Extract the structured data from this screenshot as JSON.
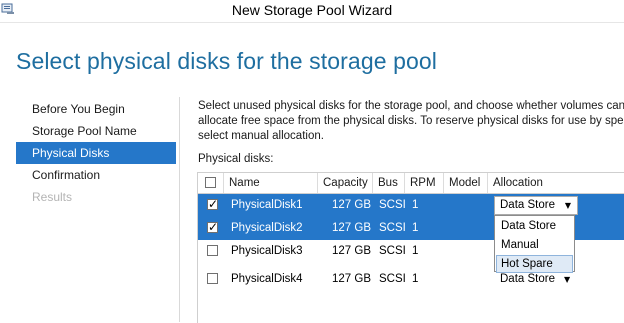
{
  "window": {
    "title": "New Storage Pool Wizard"
  },
  "page": {
    "heading": "Select physical disks for the storage pool"
  },
  "nav": {
    "items": [
      {
        "label": "Before You Begin",
        "state": "normal"
      },
      {
        "label": "Storage Pool Name",
        "state": "normal"
      },
      {
        "label": "Physical Disks",
        "state": "active"
      },
      {
        "label": "Confirmation",
        "state": "normal"
      },
      {
        "label": "Results",
        "state": "disabled"
      }
    ]
  },
  "content": {
    "description_lines": [
      "Select unused physical disks for the storage pool, and choose whether volumes can au",
      "allocate free space from the physical disks. To reserve physical disks for use by specific",
      "select manual allocation."
    ],
    "disks_label": "Physical disks:",
    "columns": [
      "Name",
      "Capacity",
      "Bus",
      "RPM",
      "Model",
      "Allocation"
    ],
    "rows": [
      {
        "checked": true,
        "selected": true,
        "name": "PhysicalDisk1",
        "capacity": "127 GB",
        "bus": "SCSI",
        "rpm": "1",
        "model": "",
        "allocation": "Data Store"
      },
      {
        "checked": true,
        "selected": true,
        "name": "PhysicalDisk2",
        "capacity": "127 GB",
        "bus": "SCSI",
        "rpm": "1",
        "model": "",
        "allocation": ""
      },
      {
        "checked": false,
        "selected": false,
        "name": "PhysicalDisk3",
        "capacity": "127 GB",
        "bus": "SCSI",
        "rpm": "1",
        "model": "",
        "allocation": ""
      },
      {
        "checked": false,
        "selected": false,
        "name": "PhysicalDisk4",
        "capacity": "127 GB",
        "bus": "SCSI",
        "rpm": "1",
        "model": "",
        "allocation": "Data Store"
      }
    ],
    "dropdown": {
      "options": [
        "Data Store",
        "Manual",
        "Hot Spare"
      ],
      "hovered": "Hot Spare"
    }
  },
  "colors": {
    "heading": "#1e6ea0",
    "selection": "#2577c9",
    "dropdown_hover": "#dfeaf6"
  }
}
